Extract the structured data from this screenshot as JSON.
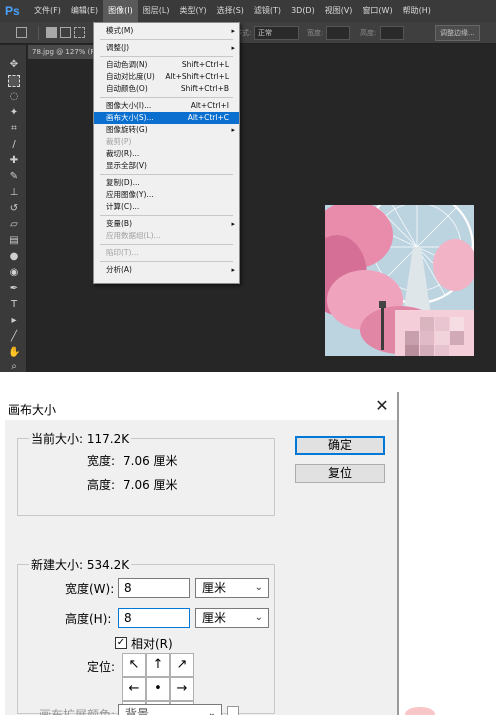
{
  "menubar": {
    "logo": "Ps",
    "items": [
      "文件(F)",
      "编辑(E)",
      "图像(I)",
      "图层(L)",
      "类型(Y)",
      "选择(S)",
      "滤镜(T)",
      "3D(D)",
      "视图(V)",
      "窗口(W)",
      "帮助(H)"
    ],
    "active_index": 2
  },
  "options_bar": {
    "style_label": "样式:",
    "style_value": "正常",
    "width_label": "宽度:",
    "height_label": "高度:",
    "refine_button": "调整边缘..."
  },
  "document": {
    "tab_label": "78.jpg @ 127% (RGB/8)"
  },
  "image_menu": {
    "items": [
      {
        "label": "模式(M)",
        "shortcut": "",
        "submenu": true,
        "disabled": false,
        "highlight": false
      },
      {
        "sep": true
      },
      {
        "label": "调整(J)",
        "shortcut": "",
        "submenu": true,
        "disabled": false,
        "highlight": false
      },
      {
        "sep": true
      },
      {
        "label": "自动色调(N)",
        "shortcut": "Shift+Ctrl+L",
        "submenu": false,
        "disabled": false,
        "highlight": false
      },
      {
        "label": "自动对比度(U)",
        "shortcut": "Alt+Shift+Ctrl+L",
        "submenu": false,
        "disabled": false,
        "highlight": false
      },
      {
        "label": "自动颜色(O)",
        "shortcut": "Shift+Ctrl+B",
        "submenu": false,
        "disabled": false,
        "highlight": false
      },
      {
        "sep": true
      },
      {
        "label": "图像大小(I)...",
        "shortcut": "Alt+Ctrl+I",
        "submenu": false,
        "disabled": false,
        "highlight": false
      },
      {
        "label": "画布大小(S)...",
        "shortcut": "Alt+Ctrl+C",
        "submenu": false,
        "disabled": false,
        "highlight": true
      },
      {
        "label": "图像旋转(G)",
        "shortcut": "",
        "submenu": true,
        "disabled": false,
        "highlight": false
      },
      {
        "label": "裁剪(P)",
        "shortcut": "",
        "submenu": false,
        "disabled": true,
        "highlight": false
      },
      {
        "label": "裁切(R)...",
        "shortcut": "",
        "submenu": false,
        "disabled": false,
        "highlight": false
      },
      {
        "label": "显示全部(V)",
        "shortcut": "",
        "submenu": false,
        "disabled": false,
        "highlight": false
      },
      {
        "sep": true
      },
      {
        "label": "复制(D)...",
        "shortcut": "",
        "submenu": false,
        "disabled": false,
        "highlight": false
      },
      {
        "label": "应用图像(Y)...",
        "shortcut": "",
        "submenu": false,
        "disabled": false,
        "highlight": false
      },
      {
        "label": "计算(C)...",
        "shortcut": "",
        "submenu": false,
        "disabled": false,
        "highlight": false
      },
      {
        "sep": true
      },
      {
        "label": "变量(B)",
        "shortcut": "",
        "submenu": true,
        "disabled": false,
        "highlight": false
      },
      {
        "label": "应用数据组(L)...",
        "shortcut": "",
        "submenu": false,
        "disabled": true,
        "highlight": false
      },
      {
        "sep": true
      },
      {
        "label": "陷印(T)...",
        "shortcut": "",
        "submenu": false,
        "disabled": true,
        "highlight": false
      },
      {
        "sep": true
      },
      {
        "label": "分析(A)",
        "shortcut": "",
        "submenu": true,
        "disabled": false,
        "highlight": false
      }
    ]
  },
  "dialog": {
    "title": "画布大小",
    "current_size": {
      "legend": "当前大小: 117.2K",
      "width_label": "宽度:",
      "width_value": "7.06 厘米",
      "height_label": "高度:",
      "height_value": "7.06 厘米"
    },
    "new_size": {
      "legend": "新建大小: 534.2K",
      "width_label": "宽度(W):",
      "width_value": "8",
      "width_unit": "厘米",
      "height_label": "高度(H):",
      "height_value": "8",
      "height_unit": "厘米",
      "relative_label": "相对(R)",
      "relative_checked": "✓",
      "anchor_label": "定位:"
    },
    "ok_button": "确定",
    "reset_button": "复位",
    "canvas_color_label": "画布扩展颜色:",
    "canvas_color_value": "背景"
  },
  "colors": {
    "ps_background": "#262626",
    "menu_highlight": "#0a6fcf",
    "dialog_accent": "#0078d7"
  }
}
